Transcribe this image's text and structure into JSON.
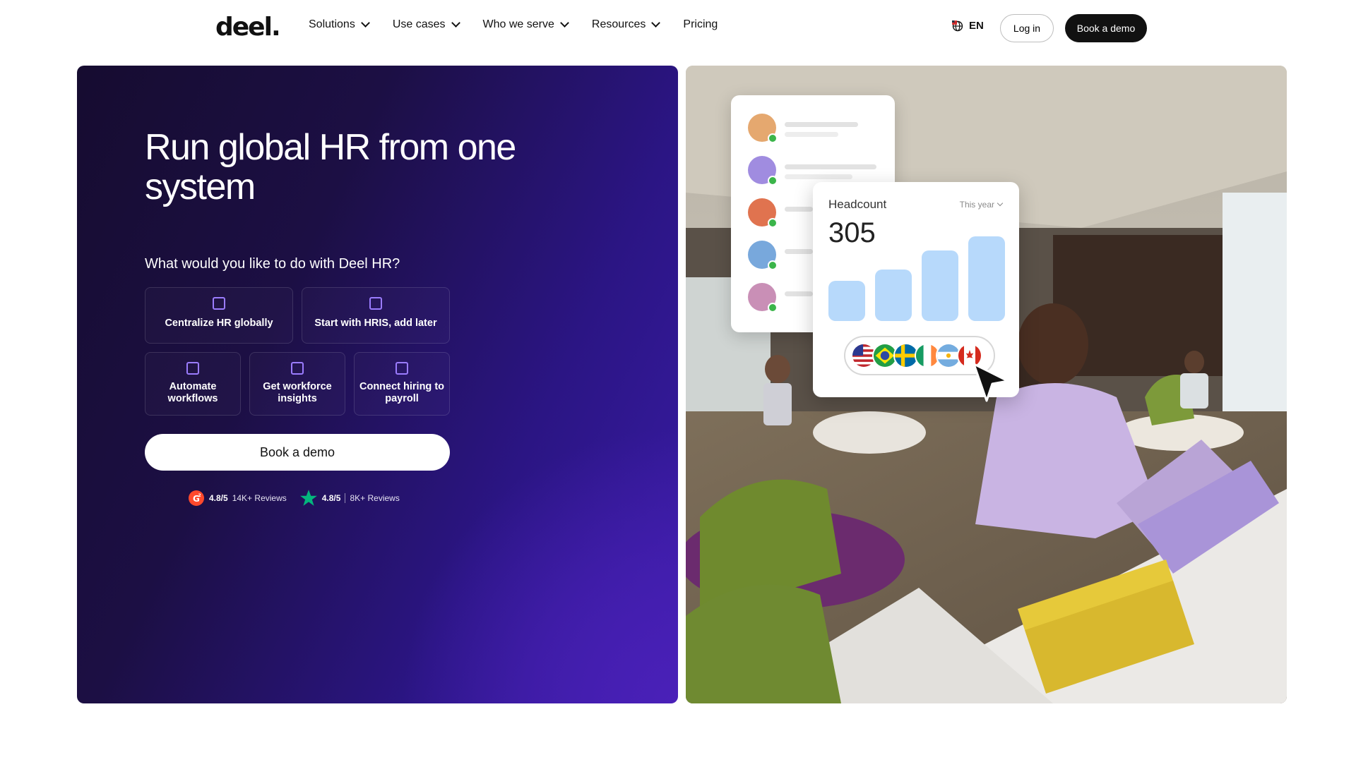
{
  "nav": {
    "logo": "deel.",
    "items": [
      {
        "label": "Solutions",
        "has_dropdown": true
      },
      {
        "label": "Use cases",
        "has_dropdown": true
      },
      {
        "label": "Who we serve",
        "has_dropdown": true
      },
      {
        "label": "Resources",
        "has_dropdown": true
      },
      {
        "label": "Pricing",
        "has_dropdown": false
      }
    ],
    "language": "EN",
    "login": "Log in",
    "book_demo": "Book a demo"
  },
  "hero": {
    "title": "Run global HR from one system",
    "question": "What would you like to do with Deel HR?",
    "options": [
      "Centralize HR globally",
      "Start with HRIS, add later",
      "Automate workflows",
      "Get workforce insights",
      "Connect hiring to payroll"
    ],
    "cta": "Book a demo",
    "reviews": [
      {
        "source_icon": "g2-icon",
        "score": "4.8/5",
        "count": "14K+ Reviews"
      },
      {
        "source_icon": "trustpilot-star-icon",
        "score": "4.8/5",
        "count": "8K+ Reviews"
      }
    ]
  },
  "headcount_card": {
    "title": "Headcount",
    "range": "This year",
    "value": "305",
    "bars": [
      0.35,
      0.45,
      0.62,
      0.74
    ],
    "flags": [
      "us-flag-icon",
      "brazil-flag-icon",
      "sweden-flag-icon",
      "ireland-flag-icon",
      "argentina-flag-icon",
      "canada-flag-icon"
    ]
  },
  "colors": {
    "hero_dark": "#160c30",
    "hero_purple": "#4a20b8",
    "checkbox": "#9b7cff",
    "bar": "#b7d9fb",
    "check_green": "#3bb54a"
  }
}
